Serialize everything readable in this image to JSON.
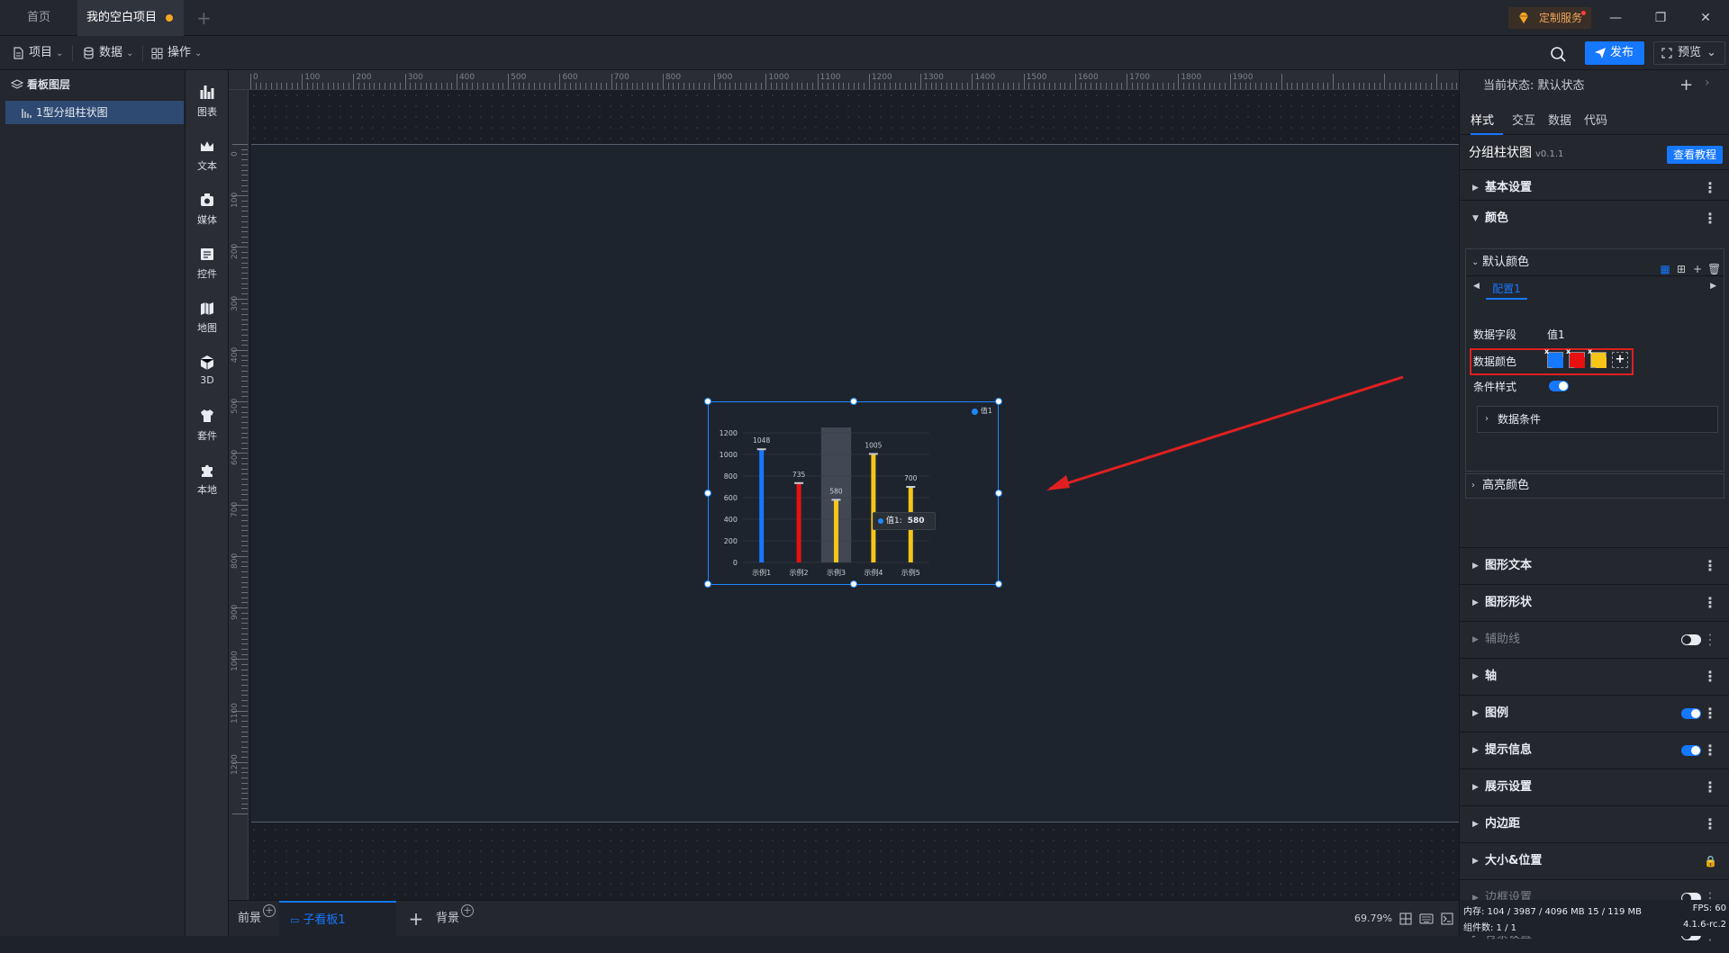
{
  "titlebar": {
    "tabs": [
      "首页",
      "我的空白项目"
    ],
    "service_label": "定制服务"
  },
  "menubar": {
    "items": [
      "项目",
      "数据",
      "操作"
    ],
    "publish_label": "发布",
    "preview_label": "预览"
  },
  "layers": {
    "title": "看板图层",
    "items": [
      "1型分组柱状图"
    ]
  },
  "tools": [
    "图表",
    "文本",
    "媒体",
    "控件",
    "地图",
    "3D",
    "套件",
    "本地"
  ],
  "ruler": {
    "h_labels": [
      "0",
      "100",
      "200",
      "300",
      "400",
      "500",
      "600",
      "700",
      "800",
      "900",
      "1000",
      "1100",
      "1200",
      "1300",
      "1400",
      "1500",
      "1600",
      "1700",
      "1800",
      "1900"
    ],
    "v_labels": [
      "0",
      "100",
      "200",
      "300",
      "400",
      "500",
      "600",
      "700",
      "800",
      "900",
      "1000",
      "1100",
      "1200"
    ]
  },
  "chart_data": {
    "type": "bar",
    "categories": [
      "示例1",
      "示例2",
      "示例3",
      "示例4",
      "示例5"
    ],
    "series": [
      {
        "name": "值1",
        "values": [
          1048,
          735,
          580,
          1005,
          700
        ]
      }
    ],
    "colors": [
      "#1677ff",
      "#e81010",
      "#f5c518",
      "#f5c518",
      "#f5c518"
    ],
    "yticks": [
      "0",
      "200",
      "400",
      "600",
      "800",
      "1000",
      "1200"
    ],
    "ylim": [
      0,
      1200
    ],
    "highlight_index": 2,
    "legend": "top-right",
    "grid": true,
    "tooltip": {
      "series": "值1",
      "value": "580"
    }
  },
  "bottombar": {
    "front_label": "前景",
    "sub_label": "子看板1",
    "back_label": "背景",
    "zoom": "69.79%"
  },
  "rpanel": {
    "state_label": "当前状态:",
    "state_value": "默认状态",
    "tabs": [
      "样式",
      "交互",
      "数据",
      "代码"
    ],
    "component_name": "分组柱状图",
    "component_version": "v0.1.1",
    "tutorial_label": "查看教程",
    "sections_top": [
      "基本设置",
      "颜色"
    ],
    "default_color": {
      "title": "默认颜色",
      "config_tab": "配置1",
      "data_field_label": "数据字段",
      "data_field_value": "值1",
      "data_color_label": "数据颜色",
      "swatches": [
        "#1677ff",
        "#e81010",
        "#f5c518"
      ],
      "cond_style_label": "条件样式",
      "data_cond_label": "数据条件"
    },
    "highlight_color": "高亮颜色",
    "sections": [
      {
        "label": "图形文本",
        "control": "more",
        "enabled": true
      },
      {
        "label": "图形形状",
        "control": "more",
        "enabled": true
      },
      {
        "label": "辅助线",
        "control": "toggle-off",
        "enabled": false
      },
      {
        "label": "轴",
        "control": "more",
        "enabled": true
      },
      {
        "label": "图例",
        "control": "toggle-on",
        "enabled": true
      },
      {
        "label": "提示信息",
        "control": "toggle-on",
        "enabled": true
      },
      {
        "label": "展示设置",
        "control": "more",
        "enabled": true
      },
      {
        "label": "内边距",
        "control": "more",
        "enabled": true
      },
      {
        "label": "大小&位置",
        "control": "lock",
        "enabled": true
      },
      {
        "label": "边框设置",
        "control": "toggle-off",
        "enabled": false
      },
      {
        "label": "背景设置",
        "control": "toggle-off",
        "enabled": false
      }
    ],
    "status": {
      "memory": "内存: 104 / 3987 / 4096 MB  15 / 119 MB",
      "fps": "FPS: 60",
      "components": "组件数: 1 / 1",
      "version": "4.1.6-rc.2"
    }
  }
}
